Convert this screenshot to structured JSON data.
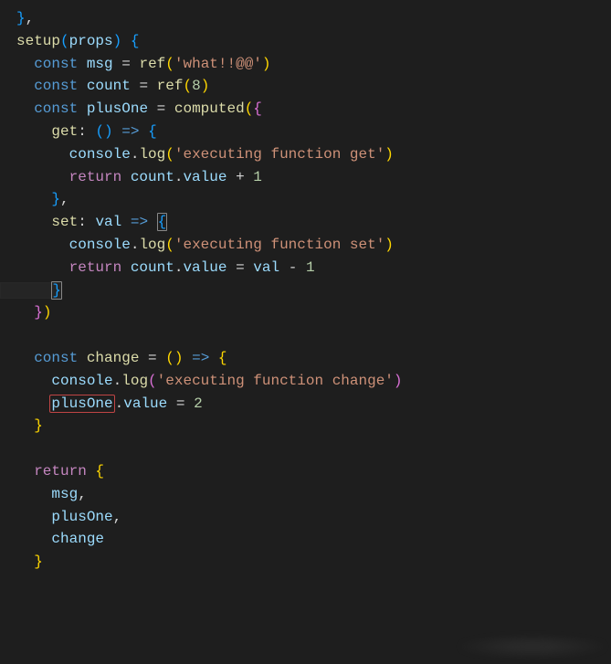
{
  "code": {
    "l1": "},",
    "fn_setup": "setup",
    "param": "props",
    "kw_const": "const",
    "kw_return": "return",
    "var_msg": "msg",
    "var_count": "count",
    "var_plusOne": "plusOne",
    "var_change": "change",
    "fn_ref": "ref",
    "fn_computed": "computed",
    "prop_get": "get",
    "prop_set": "set",
    "param_val": "val",
    "obj_console": "console",
    "fn_log": "log",
    "prop_value": "value",
    "str_msg": "'what!!@@'",
    "num_8": "8",
    "num_1": "1",
    "num_2": "2",
    "str_get": "'executing function get'",
    "str_set": "'executing function set'",
    "str_change": "'executing function change'"
  }
}
